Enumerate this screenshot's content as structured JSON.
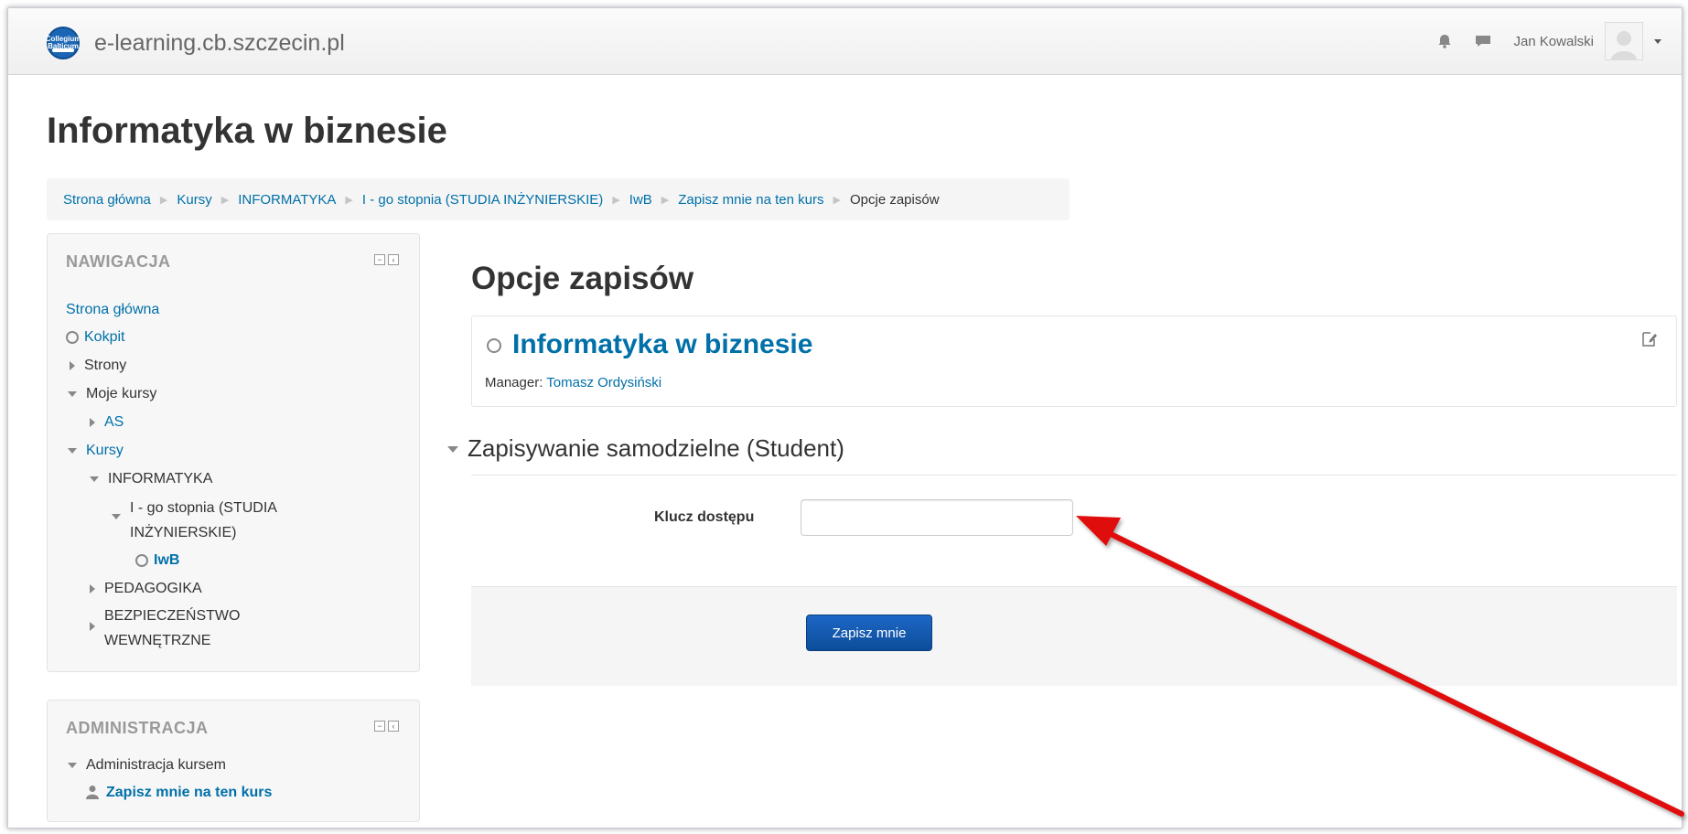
{
  "navbar": {
    "site_name": "e-learning.cb.szczecin.pl",
    "user_name": "Jan Kowalski"
  },
  "page": {
    "title": "Informatyka w biznesie"
  },
  "breadcrumb": [
    "Strona główna",
    "Kursy",
    "INFORMATYKA",
    "I - go stopnia (STUDIA INŻYNIERSKIE)",
    "IwB",
    "Zapisz mnie na ten kurs",
    "Opcje zapisów"
  ],
  "navigation_block": {
    "title": "NAWIGACJA",
    "items": [
      "Strona główna",
      "Kokpit",
      "Strony",
      "Moje kursy",
      "AS",
      "Kursy",
      "INFORMATYKA",
      "I - go stopnia (STUDIA",
      "INŻYNIERSKIE)",
      "IwB",
      "PEDAGOGIKA",
      "BEZPIECZEŃSTWO",
      "WEWNĘTRZNE"
    ]
  },
  "admin_block": {
    "title": "ADMINISTRACJA",
    "items": [
      "Administracja kursem",
      "Zapisz mnie na ten kurs"
    ]
  },
  "main": {
    "heading": "Opcje zapisów",
    "course_title": "Informatyka w biznesie",
    "manager_label": "Manager:",
    "manager_name": "Tomasz Ordysiński",
    "section_title": "Zapisywanie samodzielne (Student)",
    "field_label": "Klucz dostępu",
    "field_value": "",
    "submit_label": "Zapisz mnie"
  },
  "annotation": {
    "arrow_color": "#e01010"
  }
}
